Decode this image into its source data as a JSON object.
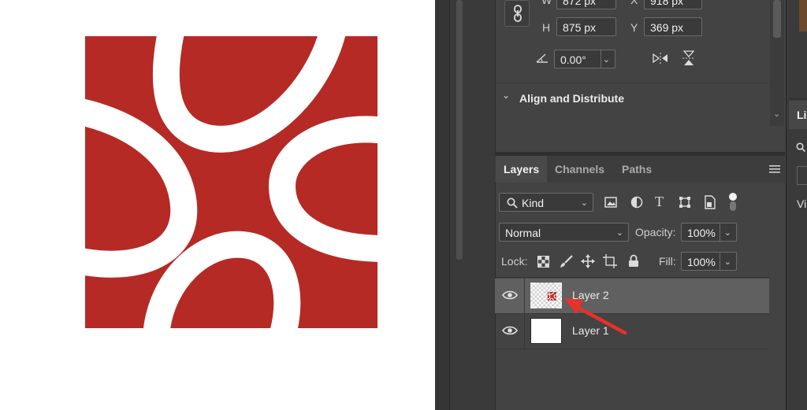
{
  "properties": {
    "w_label": "W",
    "w_value": "872 px",
    "x_label": "X",
    "x_value": "918 px",
    "h_label": "H",
    "h_value": "875 px",
    "y_label": "Y",
    "y_value": "369 px",
    "angle_value": "0.00°"
  },
  "align_section": {
    "title": "Align and Distribute"
  },
  "layers_panel": {
    "tabs": [
      {
        "label": "Layers",
        "active": true
      },
      {
        "label": "Channels",
        "active": false
      },
      {
        "label": "Paths",
        "active": false
      }
    ],
    "filter_kind": "Kind",
    "blend_mode": "Normal",
    "opacity_label": "Opacity:",
    "opacity_value": "100%",
    "lock_label": "Lock:",
    "fill_label": "Fill:",
    "fill_value": "100%",
    "layers": [
      {
        "name": "Layer 2",
        "selected": true
      },
      {
        "name": "Layer 1",
        "selected": false
      }
    ]
  },
  "side_panel": {
    "tab_partial": "Li",
    "vi_partial": "Vi"
  },
  "colors": {
    "artwork_red": "#b52a25",
    "panel_bg": "#434343",
    "annotation_arrow": "#e8312a"
  },
  "icons": [
    "link-icon",
    "angle-icon",
    "flip-horizontal-icon",
    "flip-vertical-icon",
    "chevron-down-icon",
    "panel-menu-icon",
    "search-icon",
    "image-filter-icon",
    "adjustment-filter-icon",
    "type-filter-icon",
    "shape-filter-icon",
    "smart-object-filter-icon",
    "filter-toggle-icon",
    "lock-transparent-icon",
    "lock-paint-icon",
    "lock-position-icon",
    "lock-artboard-icon",
    "lock-all-icon",
    "eye-icon",
    "annotation-arrow"
  ]
}
